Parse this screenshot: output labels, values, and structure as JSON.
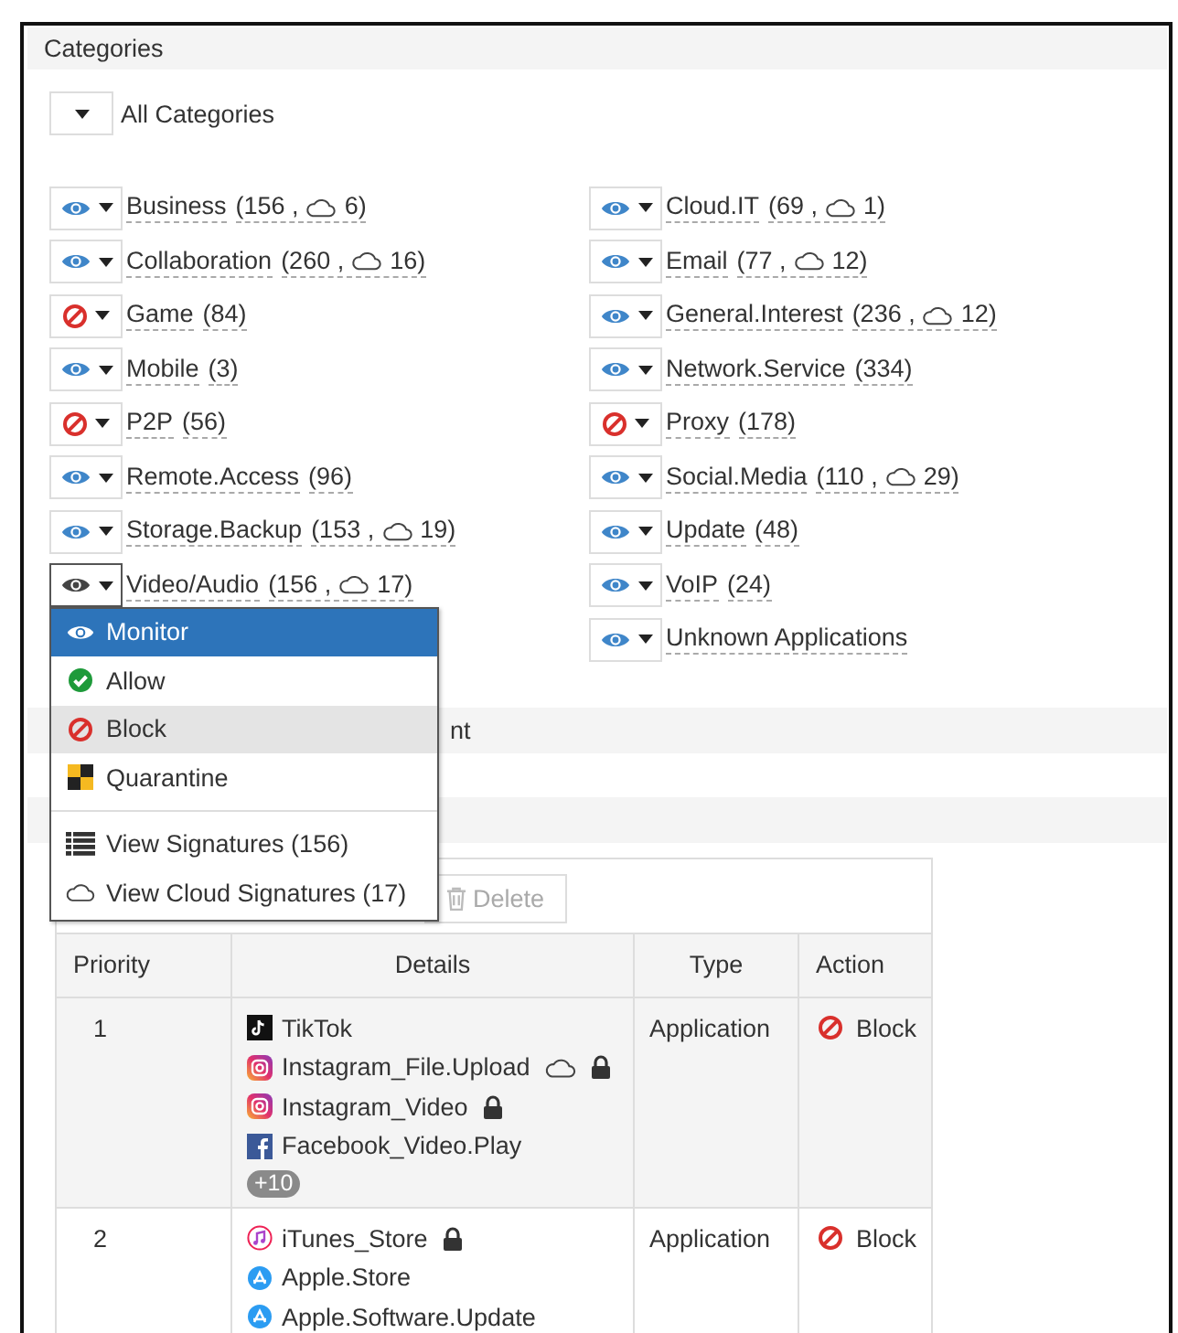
{
  "categories": {
    "title": "Categories",
    "all": {
      "label": "All Categories"
    },
    "left_column": [
      {
        "name": "Business",
        "count": "(156 ,",
        "cloud_count": "6)",
        "kind": "monitor",
        "open": false
      },
      {
        "name": "Collaboration",
        "count": "(260 ,",
        "cloud_count": "16)",
        "kind": "monitor",
        "open": false
      },
      {
        "name": "Game",
        "count": "(84)",
        "kind": "block",
        "open": false
      },
      {
        "name": "Mobile",
        "count": "(3)",
        "kind": "monitor",
        "open": false
      },
      {
        "name": "P2P",
        "count": "(56)",
        "kind": "block",
        "open": false
      },
      {
        "name": "Remote.Access",
        "count": "(96)",
        "kind": "monitor",
        "open": false
      },
      {
        "name": "Storage.Backup",
        "count": "(153 ,",
        "cloud_count": "19)",
        "kind": "monitor",
        "open": false
      },
      {
        "name": "Video/Audio",
        "count": "(156 ,",
        "cloud_count": "17)",
        "kind": "monitor",
        "open": true
      }
    ],
    "right_column": [
      {
        "name": "Cloud.IT",
        "count": "(69 ,",
        "cloud_count": "1)",
        "kind": "monitor",
        "open": false
      },
      {
        "name": "Email",
        "count": "(77 ,",
        "cloud_count": "12)",
        "kind": "monitor",
        "open": false
      },
      {
        "name": "General.Interest",
        "count": "(236 ,",
        "cloud_count": "12)",
        "kind": "monitor",
        "open": false
      },
      {
        "name": "Network.Service",
        "count": "(334)",
        "kind": "monitor",
        "open": false
      },
      {
        "name": "Proxy",
        "count": "(178)",
        "kind": "block",
        "open": false
      },
      {
        "name": "Social.Media",
        "count": "(110 ,",
        "cloud_count": "29)",
        "kind": "monitor",
        "open": false
      },
      {
        "name": "Update",
        "count": "(48)",
        "kind": "monitor",
        "open": false
      },
      {
        "name": "VoIP",
        "count": "(24)",
        "kind": "monitor",
        "open": false
      },
      {
        "name": "Unknown Applications",
        "kind": "monitor",
        "open": false
      }
    ]
  },
  "action_menu": {
    "actions": [
      {
        "label": "Monitor",
        "kind": "monitor",
        "selected": true,
        "hovered": false
      },
      {
        "label": "Allow",
        "kind": "allow",
        "selected": false,
        "hovered": false
      },
      {
        "label": "Block",
        "kind": "block",
        "selected": false,
        "hovered": true
      },
      {
        "label": "Quarantine",
        "kind": "quarantine",
        "selected": false,
        "hovered": false
      }
    ],
    "links": [
      {
        "label": "View Signatures (156)",
        "kind": "list"
      },
      {
        "label": "View Cloud Signatures (17)",
        "kind": "cloud"
      }
    ]
  },
  "partial_section": {
    "text": "nt"
  },
  "toolbar": {
    "delete": {
      "label": "Delete",
      "disabled": true
    }
  },
  "table": {
    "columns": [
      "Priority",
      "Details",
      "Type",
      "Action"
    ],
    "rows": [
      {
        "priority": "1",
        "details": [
          {
            "name": "TikTok",
            "kind": "tiktok",
            "cloud": false,
            "locked": false
          },
          {
            "name": "Instagram_File.Upload",
            "kind": "instagram",
            "cloud": true,
            "locked": true
          },
          {
            "name": "Instagram_Video",
            "kind": "instagram",
            "cloud": false,
            "locked": true
          },
          {
            "name": "Facebook_Video.Play",
            "kind": "facebook",
            "cloud": false,
            "locked": false
          }
        ],
        "more": "+10",
        "type": "Application",
        "action": {
          "label": "Block",
          "kind": "block"
        }
      },
      {
        "priority": "2",
        "details": [
          {
            "name": "iTunes_Store",
            "kind": "itunes",
            "cloud": false,
            "locked": true
          },
          {
            "name": "Apple.Store",
            "kind": "appstore",
            "cloud": false,
            "locked": false
          },
          {
            "name": "Apple.Software.Update",
            "kind": "appstore",
            "cloud": false,
            "locked": false
          }
        ],
        "type": "Application",
        "action": {
          "label": "Block",
          "kind": "block"
        }
      }
    ]
  }
}
